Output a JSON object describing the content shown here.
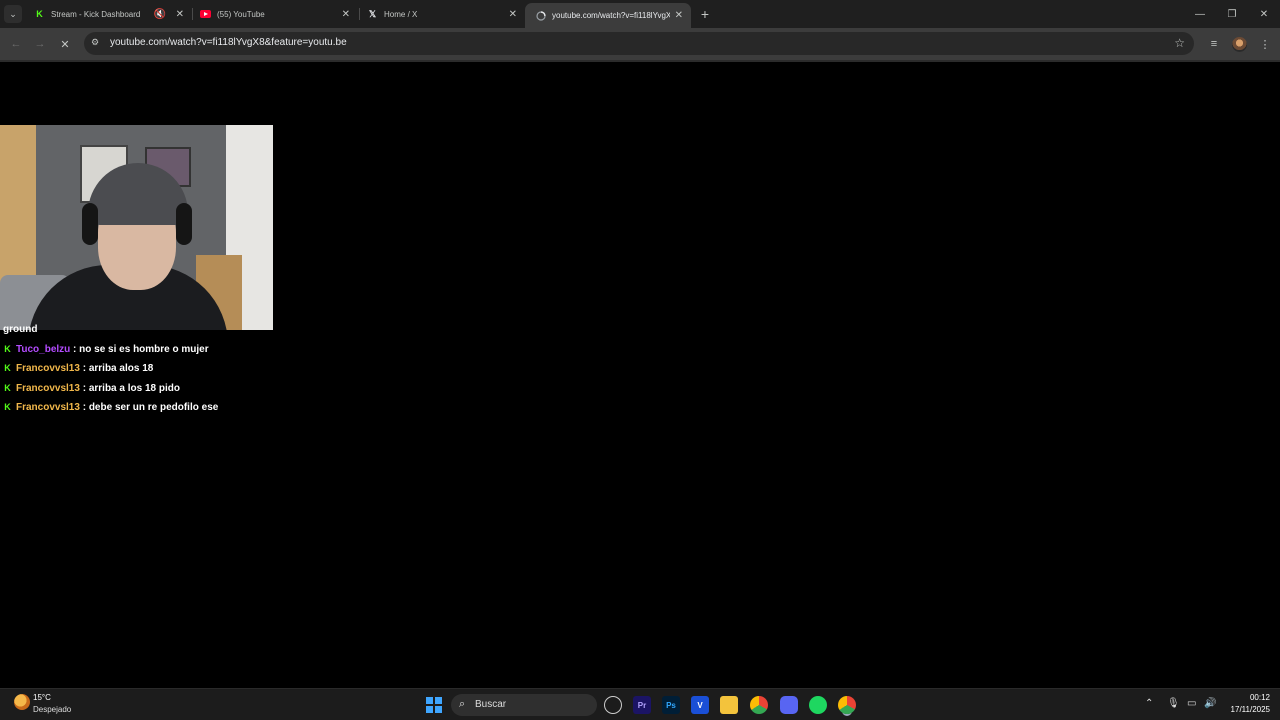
{
  "browser": {
    "tabs": [
      {
        "title": "Stream - Kick Dashboard",
        "favicon": "kick-icon",
        "muted": true
      },
      {
        "title": "(55) YouTube",
        "favicon": "youtube-icon"
      },
      {
        "title": "Home / X",
        "favicon": "x-icon"
      },
      {
        "title": "youtube.com/watch?v=fi118lYvgX",
        "favicon": "globe-icon",
        "active": true
      }
    ],
    "new_tab_symbol": "+",
    "url": "youtube.com/watch?v=fi118lYvgX8&feature=youtu.be",
    "accent": "#3c3c3c"
  },
  "chat": {
    "partial_line": "ground",
    "messages": [
      {
        "user": "Tuco_belzu",
        "user_color": "#b44cff",
        "text": "no se si es hombre o mujer"
      },
      {
        "user": "Francovvsl13",
        "user_color": "#f2b84b",
        "text": "arriba alos 18"
      },
      {
        "user": "Francovvsl13",
        "user_color": "#f2b84b",
        "text": "arriba a los 18 pido"
      },
      {
        "user": "Francovvsl13",
        "user_color": "#f2b84b",
        "text": "debe ser un re pedofilo ese"
      }
    ],
    "badge_color": "#53fc18"
  },
  "taskbar": {
    "weather_temp": "15°C",
    "weather_desc": "Despejado",
    "search_placeholder": "Buscar",
    "apps": [
      "copilot-icon",
      "premiere-icon",
      "photoshop-icon",
      "vegas-icon",
      "file-explorer-icon",
      "chrome-icon",
      "discord-icon",
      "spotify-icon",
      "chrome-active-icon"
    ],
    "time": "00:12",
    "date": "17/11/2025"
  }
}
